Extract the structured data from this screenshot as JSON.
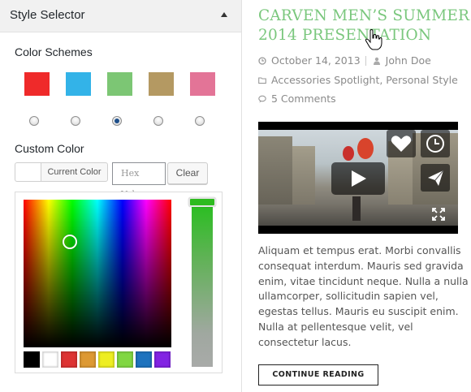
{
  "style_selector": {
    "title": "Style Selector",
    "color_schemes_label": "Color Schemes",
    "schemes": [
      {
        "color": "#ef2a2a",
        "selected": false
      },
      {
        "color": "#33b3e8",
        "selected": false
      },
      {
        "color": "#7cc674",
        "selected": true
      },
      {
        "color": "#b49962",
        "selected": false
      },
      {
        "color": "#e37497",
        "selected": false
      }
    ],
    "custom_color_label": "Custom Color",
    "current_color_button": "Current Color",
    "hex_placeholder": "Hex Value",
    "clear_button": "Clear",
    "palette": [
      "#000000",
      "#ffffff",
      "#dd3333",
      "#dd9933",
      "#eeee22",
      "#81d742",
      "#1e73be",
      "#8224e3"
    ]
  },
  "post": {
    "title_line1": "CARVEN MEN’S SUMMER",
    "title_line2": "2014 PRESENTATION",
    "title_color": "#7ac77d",
    "date": "October 14, 2013",
    "author": "John Doe",
    "categories": "Accessories Spotlight, Personal Style",
    "comments": "5 Comments",
    "excerpt_lines": [
      "Aliquam et tempus erat. Morbi convallis",
      "consequat interdum. Mauris sed gravida",
      "enim, vitae tincidunt neque. Nulla a nulla",
      "ullamcorper, sollicitudin sapien vel,",
      "egestas tellus. Mauris eu suscipit enim.",
      "Nulla at pellentesque velit, vel",
      "consectetur lacus."
    ],
    "continue_button": "CONTINUE READING"
  }
}
